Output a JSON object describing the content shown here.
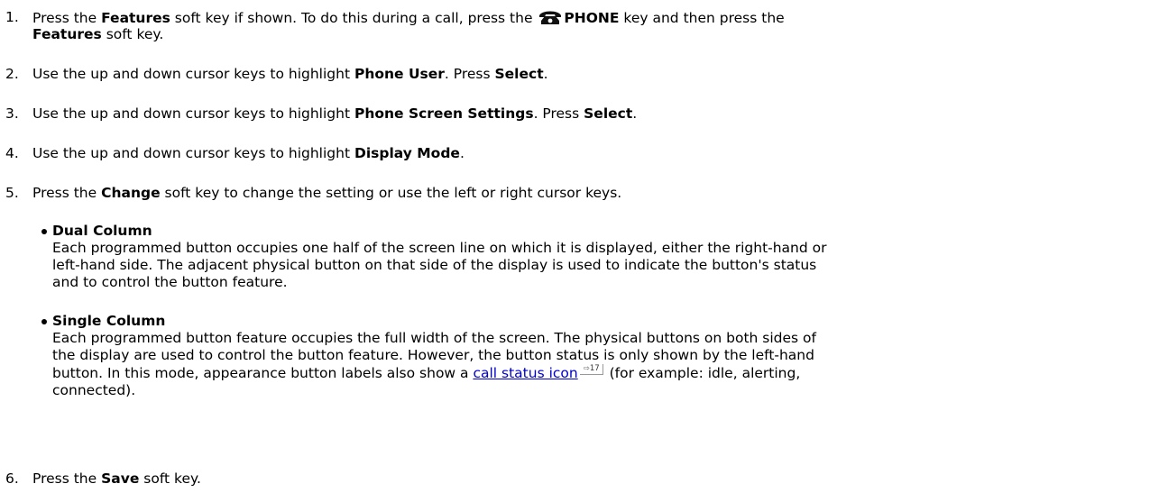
{
  "steps": [
    {
      "num": "1.",
      "a": "Press the ",
      "b1": "Features",
      "c": " soft key if shown. To do this during a call, press the ",
      "icon": "phone-icon",
      "b2": "PHONE",
      "d": " key and then press the",
      "b3": "Features",
      "e": " soft key."
    },
    {
      "num": "2.",
      "a": "Use the up and down cursor keys to highlight ",
      "b1": "Phone User",
      "c": ". Press ",
      "b2": "Select",
      "d": "."
    },
    {
      "num": "3.",
      "a": "Use the up and down cursor keys to highlight ",
      "b1": "Phone Screen Settings",
      "c": ". Press ",
      "b2": "Select",
      "d": "."
    },
    {
      "num": "4.",
      "a": "Use the up and down cursor keys to highlight ",
      "b1": "Display Mode",
      "c": "."
    },
    {
      "num": "5.",
      "a": "Press the ",
      "b1": "Change",
      "c": " soft key to change the setting or use the left or right cursor keys."
    },
    {
      "num": "6.",
      "a": "Press the ",
      "b1": "Save",
      "c": " soft key."
    }
  ],
  "options": [
    {
      "title": "Dual Column",
      "lines": [
        "Each programmed button occupies one half of the screen line on which it is displayed, either the right-hand or",
        "left-hand side. The adjacent physical button on that side of the display is used to indicate the button's status",
        "and to control the button feature."
      ]
    },
    {
      "title": "Single Column",
      "line1": "Each programmed button feature occupies the full width of the screen. The physical buttons on both sides of",
      "line2": "the display are used to control the button feature. However, the button status is only shown by the left-hand",
      "line3a": "button. In this mode, appearance button labels also show a ",
      "link": "call status icon",
      "ref_arrow": "⇨",
      "ref_page": "17",
      "line3b": " (for example: idle, alerting,",
      "line4": "connected)."
    }
  ]
}
